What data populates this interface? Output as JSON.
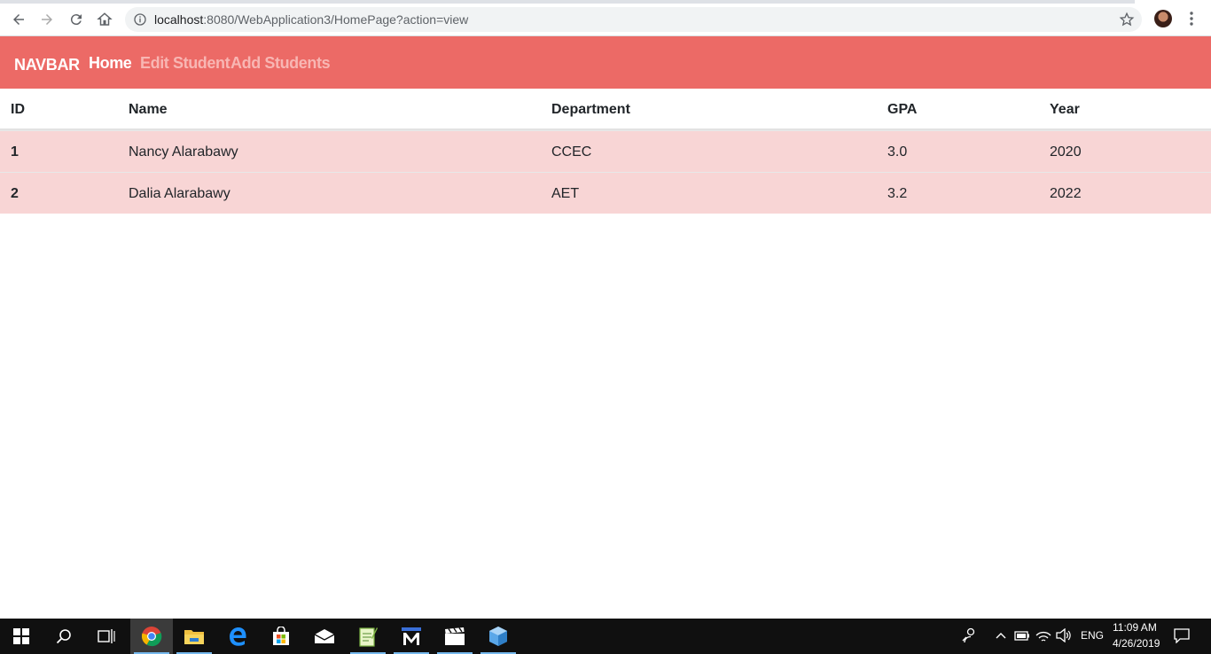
{
  "browser": {
    "url_host": "localhost",
    "url_rest": ":8080/WebApplication3/HomePage?action=view"
  },
  "navbar": {
    "brand": "NAVBAR",
    "links": [
      {
        "label": "Home",
        "active": true
      },
      {
        "label": "Edit Student",
        "active": false
      },
      {
        "label": "Add Students",
        "active": false
      }
    ]
  },
  "table": {
    "headers": [
      "ID",
      "Name",
      "Department",
      "GPA",
      "Year"
    ],
    "rows": [
      [
        "1",
        "Nancy Alarabawy",
        "CCEC",
        "3.0",
        "2020"
      ],
      [
        "2",
        "Dalia Alarabawy",
        "AET",
        "3.2",
        "2022"
      ]
    ]
  },
  "taskbar": {
    "apps": [
      "start-icon",
      "search-icon",
      "task-view-icon",
      "chrome-icon",
      "file-explorer-icon",
      "edge-icon",
      "store-icon",
      "mail-icon",
      "notepad-icon",
      "app-m-icon",
      "movies-icon",
      "box-icon"
    ],
    "language": "ENG",
    "time": "11:09 AM",
    "date": "4/26/2019"
  },
  "colors": {
    "navbar": "#ec6a66",
    "row": "#f8d5d5"
  }
}
